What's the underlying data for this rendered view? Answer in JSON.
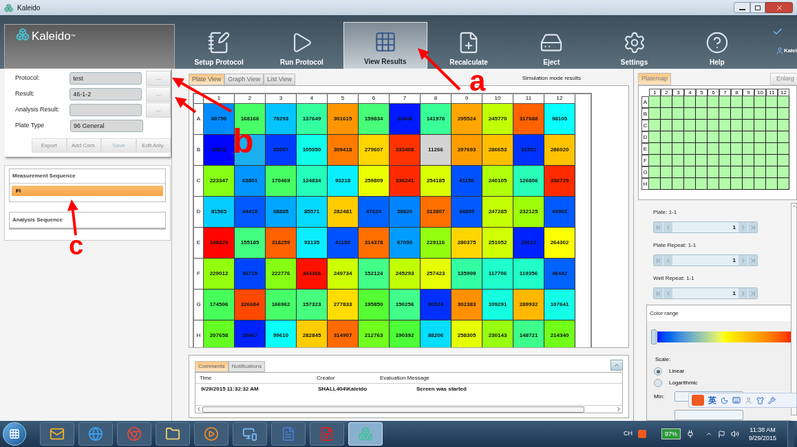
{
  "window": {
    "title": "Kaleido"
  },
  "logo": {
    "name": "Kaleido",
    "mark": "™"
  },
  "toolbar": [
    {
      "label": "Setup Protocol",
      "kind": "setup",
      "selected": false
    },
    {
      "label": "Run Protocol",
      "kind": "run",
      "selected": false
    },
    {
      "label": "View Results",
      "kind": "view",
      "selected": true
    },
    {
      "label": "Recalculate",
      "kind": "recalc",
      "selected": false
    },
    {
      "label": "Eject",
      "kind": "eject",
      "selected": false
    },
    {
      "label": "Settings",
      "kind": "settings",
      "selected": false
    },
    {
      "label": "Help",
      "kind": "help",
      "selected": false
    }
  ],
  "user": {
    "name": "Kalei"
  },
  "protocol_panel": {
    "fields": [
      {
        "label": "Protocol:",
        "value": "test",
        "browse": "..."
      },
      {
        "label": "Result:",
        "value": "46-1-2",
        "browse": "..."
      },
      {
        "label": "Analysis Result:",
        "browse": "..."
      },
      {
        "label": "Plate Type",
        "value": "96 General"
      }
    ],
    "actions": [
      {
        "label": "Export",
        "disabled": false
      },
      {
        "label": "Add Com.",
        "disabled": false
      },
      {
        "label": "Save",
        "disabled": true
      },
      {
        "label": "Edit Anly.",
        "disabled": false
      }
    ]
  },
  "measurement_sequence": {
    "title": "Measurement Sequence",
    "items": [
      {
        "label": "FI",
        "selected": true
      }
    ]
  },
  "analysis_sequence": {
    "title": "Analysis Sequence"
  },
  "view_tabs": [
    {
      "label": "Plate View",
      "selected": true
    },
    {
      "label": "Graph View",
      "selected": false
    },
    {
      "label": "List View",
      "selected": false
    }
  ],
  "mode_note": "Simulation mode results",
  "plate": {
    "columns": [
      "1",
      "2",
      "3",
      "4",
      "5",
      "6",
      "7",
      "8",
      "9",
      "10",
      "11",
      "12"
    ],
    "rows": [
      {
        "label": "A",
        "cells": [
          {
            "value": "60750",
            "excluded": false
          },
          {
            "value": "168166",
            "excluded": false
          },
          {
            "value": "79293",
            "excluded": false
          },
          {
            "value": "137649",
            "excluded": false
          },
          {
            "value": "301615",
            "excluded": false
          },
          {
            "value": "159834",
            "excluded": false
          },
          {
            "value": "23448",
            "excluded": false
          },
          {
            "value": "141976",
            "excluded": false
          },
          {
            "value": "295524",
            "excluded": false
          },
          {
            "value": "245770",
            "excluded": false
          },
          {
            "value": "317688",
            "excluded": false
          },
          {
            "value": "98105",
            "excluded": false
          }
        ]
      },
      {
        "label": "B",
        "cells": [
          {
            "value": "15811",
            "excluded": false
          },
          {
            "excluded": false
          },
          {
            "value": "35007",
            "excluded": false
          },
          {
            "value": "105950",
            "excluded": false
          },
          {
            "value": "309418",
            "excluded": false
          },
          {
            "value": "279607",
            "excluded": false
          },
          {
            "value": "333408",
            "excluded": false
          },
          {
            "value": "11266",
            "excluded": true
          },
          {
            "value": "297693",
            "excluded": false
          },
          {
            "value": "286653",
            "excluded": false
          },
          {
            "value": "31552",
            "excluded": false
          },
          {
            "value": "286020",
            "excluded": false
          }
        ]
      },
      {
        "label": "C",
        "cells": [
          {
            "value": "223347",
            "excluded": false
          },
          {
            "value": "63801",
            "excluded": false
          },
          {
            "value": "170469",
            "excluded": false
          },
          {
            "value": "124834",
            "excluded": false
          },
          {
            "value": "93218",
            "excluded": false
          },
          {
            "value": "259809",
            "excluded": false
          },
          {
            "value": "336241",
            "excluded": false
          },
          {
            "value": "254185",
            "excluded": false
          },
          {
            "value": "41150",
            "excluded": false
          },
          {
            "value": "240105",
            "excluded": false
          },
          {
            "value": "126806",
            "excluded": false
          },
          {
            "value": "336729",
            "excluded": false
          }
        ]
      },
      {
        "label": "D",
        "cells": [
          {
            "value": "81565",
            "excluded": false
          },
          {
            "value": "44418",
            "excluded": false
          },
          {
            "value": "68885",
            "excluded": false
          },
          {
            "value": "85571",
            "excluded": false
          },
          {
            "value": "282481",
            "excluded": false
          },
          {
            "value": "47624",
            "excluded": false
          },
          {
            "value": "58820",
            "excluded": false
          },
          {
            "value": "313807",
            "excluded": false
          },
          {
            "value": "44895",
            "excluded": false
          },
          {
            "value": "247285",
            "excluded": false
          },
          {
            "value": "232125",
            "excluded": false
          },
          {
            "value": "44968",
            "excluded": false
          }
        ]
      },
      {
        "label": "E",
        "cells": [
          {
            "value": "348329",
            "excluded": false
          },
          {
            "value": "155185",
            "excluded": false
          },
          {
            "value": "318259",
            "excluded": false
          },
          {
            "value": "93135",
            "excluded": false
          },
          {
            "value": "41150",
            "excluded": false
          },
          {
            "value": "314378",
            "excluded": false
          },
          {
            "value": "67090",
            "excluded": false
          },
          {
            "value": "229116",
            "excluded": false
          },
          {
            "value": "280375",
            "excluded": false
          },
          {
            "value": "251052",
            "excluded": false
          },
          {
            "value": "26612",
            "excluded": false
          },
          {
            "value": "264302",
            "excluded": false
          }
        ]
      },
      {
        "label": "F",
        "cells": [
          {
            "value": "229012",
            "excluded": false
          },
          {
            "value": "36719",
            "excluded": false
          },
          {
            "value": "222776",
            "excluded": false
          },
          {
            "value": "344366",
            "excluded": false
          },
          {
            "value": "249734",
            "excluded": false
          },
          {
            "value": "152124",
            "excluded": false
          },
          {
            "value": "245293",
            "excluded": false
          },
          {
            "value": "257423",
            "excluded": false
          },
          {
            "value": "135999",
            "excluded": false
          },
          {
            "value": "117706",
            "excluded": false
          },
          {
            "value": "119356",
            "excluded": false
          },
          {
            "value": "46442",
            "excluded": false
          }
        ]
      },
      {
        "label": "G",
        "cells": [
          {
            "value": "174506",
            "excluded": false
          },
          {
            "value": "326684",
            "excluded": false
          },
          {
            "value": "166962",
            "excluded": false
          },
          {
            "value": "157323",
            "excluded": false
          },
          {
            "value": "277833",
            "excluded": false
          },
          {
            "value": "195850",
            "excluded": false
          },
          {
            "value": "150256",
            "excluded": false
          },
          {
            "value": "30524",
            "excluded": false
          },
          {
            "value": "302383",
            "excluded": false
          },
          {
            "value": "109291",
            "excluded": false
          },
          {
            "value": "289932",
            "excluded": false
          },
          {
            "value": "107641",
            "excluded": false
          }
        ]
      },
      {
        "label": "H",
        "cells": [
          {
            "value": "207658",
            "excluded": false
          },
          {
            "value": "26467",
            "excluded": false
          },
          {
            "value": "99610",
            "excluded": false
          },
          {
            "value": "282845",
            "excluded": false
          },
          {
            "value": "314907",
            "excluded": false
          },
          {
            "value": "212763",
            "excluded": false
          },
          {
            "value": "190392",
            "excluded": false
          },
          {
            "value": "88206",
            "excluded": false
          },
          {
            "value": "258305",
            "excluded": false
          },
          {
            "value": "230143",
            "excluded": false
          },
          {
            "value": "148721",
            "excluded": false
          },
          {
            "value": "214340",
            "excluded": false
          }
        ]
      }
    ]
  },
  "comments": {
    "tabs": [
      {
        "label": "Comments",
        "selected": true
      },
      {
        "label": "Notifications",
        "selected": false
      }
    ],
    "columns": [
      "Time",
      "Creator",
      "Evaluation Message"
    ],
    "rows": [
      [
        "9/29/2015 11:32:32 AM",
        "SHALL404\\Kaleido",
        "Screen was started"
      ]
    ]
  },
  "platemap": {
    "tabs": [
      {
        "label": "Platemap",
        "selected": true
      }
    ],
    "enlarge": "Enlarg",
    "columns": [
      "1",
      "2",
      "3",
      "4",
      "5",
      "6",
      "7",
      "8",
      "9",
      "10",
      "11",
      "12"
    ],
    "rows": [
      "A",
      "B",
      "C",
      "D",
      "E",
      "F",
      "G",
      "H"
    ]
  },
  "navigators": [
    {
      "label": "Plate: 1-1",
      "value": "1"
    },
    {
      "label": "Plate Repeat: 1-1",
      "value": "1"
    },
    {
      "label": "Well Repeat: 1-1",
      "value": "1"
    }
  ],
  "color_range": {
    "title": "Color range",
    "level": 0,
    "scale_label": "Scale:",
    "scales": [
      {
        "label": "Linear",
        "selected": true
      },
      {
        "label": "Logarithmic",
        "selected": false
      }
    ],
    "min_label": "Min:"
  },
  "ime_bar": {
    "mode": "英"
  },
  "annotations": [
    {
      "label": "a"
    },
    {
      "label": "b"
    },
    {
      "label": "c"
    }
  ],
  "taskbar": {
    "apps": [
      {
        "kind": "outlook",
        "selected": false
      },
      {
        "kind": "ie",
        "selected": false
      },
      {
        "kind": "chrome",
        "selected": false
      },
      {
        "kind": "explorer",
        "selected": false
      },
      {
        "kind": "media",
        "selected": false
      },
      {
        "kind": "lync",
        "selected": false
      },
      {
        "kind": "word",
        "selected": false
      },
      {
        "kind": "acrobat",
        "selected": false
      },
      {
        "kind": "kaleido",
        "selected": true
      }
    ],
    "language": "CH",
    "battery": "97%",
    "time": "11:38 AM",
    "date": "9/29/2015"
  }
}
